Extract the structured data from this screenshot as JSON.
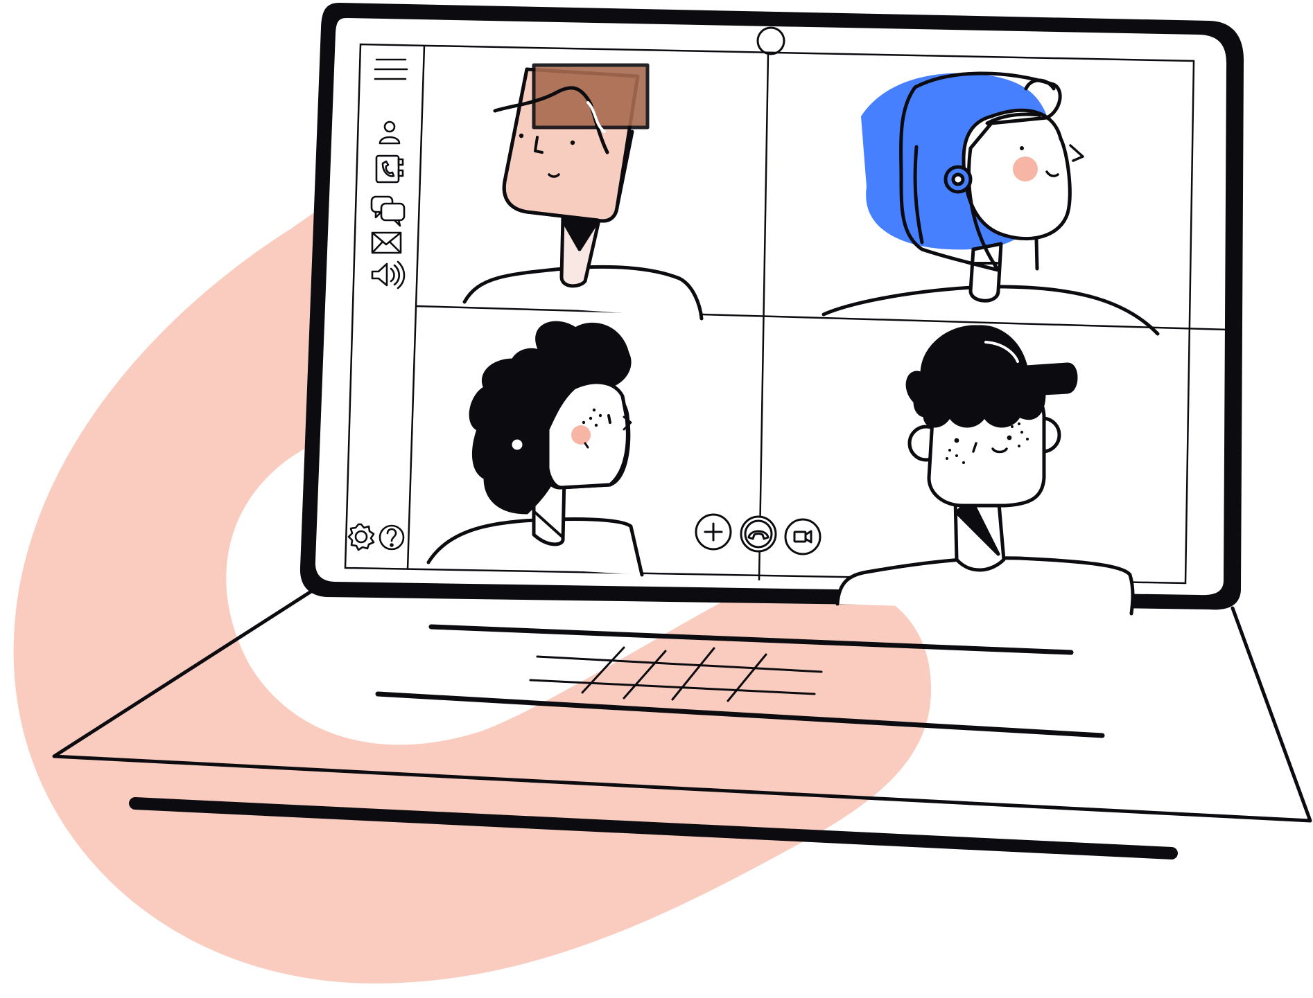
{
  "illustration": {
    "subject": "laptop-video-call",
    "palette": {
      "ink": "#0b0b10",
      "blob": "#f9ccbf",
      "skin_tan": "#f7cdbf",
      "hair_brown": "#a86b50",
      "hair_blue": "#4680ff",
      "paper": "#ffffff",
      "blush": "#f6b5a5",
      "collar_light": "#f8e7e2"
    }
  },
  "sidebar": {
    "icons": [
      {
        "icon": "menu-icon"
      },
      {
        "icon": "contacts-icon"
      },
      {
        "icon": "phone-book-icon"
      },
      {
        "icon": "chat-icon"
      },
      {
        "icon": "mail-icon"
      },
      {
        "icon": "volume-icon"
      },
      {
        "icon": "settings-icon"
      },
      {
        "icon": "help-icon"
      }
    ]
  },
  "call_controls": [
    {
      "icon": "add-participant-icon"
    },
    {
      "icon": "hang-up-icon"
    },
    {
      "icon": "video-camera-icon"
    }
  ],
  "participants": [
    {
      "tile": "top-left",
      "hair": "brown"
    },
    {
      "tile": "top-right",
      "hair": "blue"
    },
    {
      "tile": "bottom-left",
      "hair": "black-curly"
    },
    {
      "tile": "bottom-right",
      "hair": "black-cap"
    }
  ]
}
